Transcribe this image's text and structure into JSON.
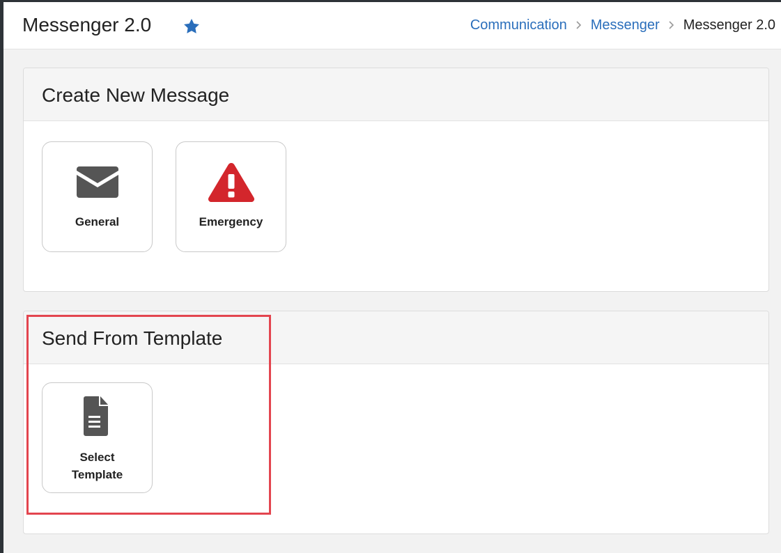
{
  "header": {
    "title": "Messenger 2.0",
    "favorite_icon": "star-icon",
    "breadcrumb": {
      "items": [
        "Communication",
        "Messenger"
      ],
      "current": "Messenger 2.0"
    }
  },
  "create_panel": {
    "title": "Create New Message",
    "tiles": [
      {
        "label": "General",
        "icon": "envelope-icon"
      },
      {
        "label": "Emergency",
        "icon": "warning-icon"
      }
    ]
  },
  "template_panel": {
    "title": "Send From Template",
    "tiles": [
      {
        "label": "Select\nTemplate",
        "icon": "document-icon"
      }
    ]
  },
  "colors": {
    "accent": "#2a6ebb",
    "emergency": "#d3262c",
    "icon_gray": "#555555",
    "highlight": "#e3454f"
  }
}
